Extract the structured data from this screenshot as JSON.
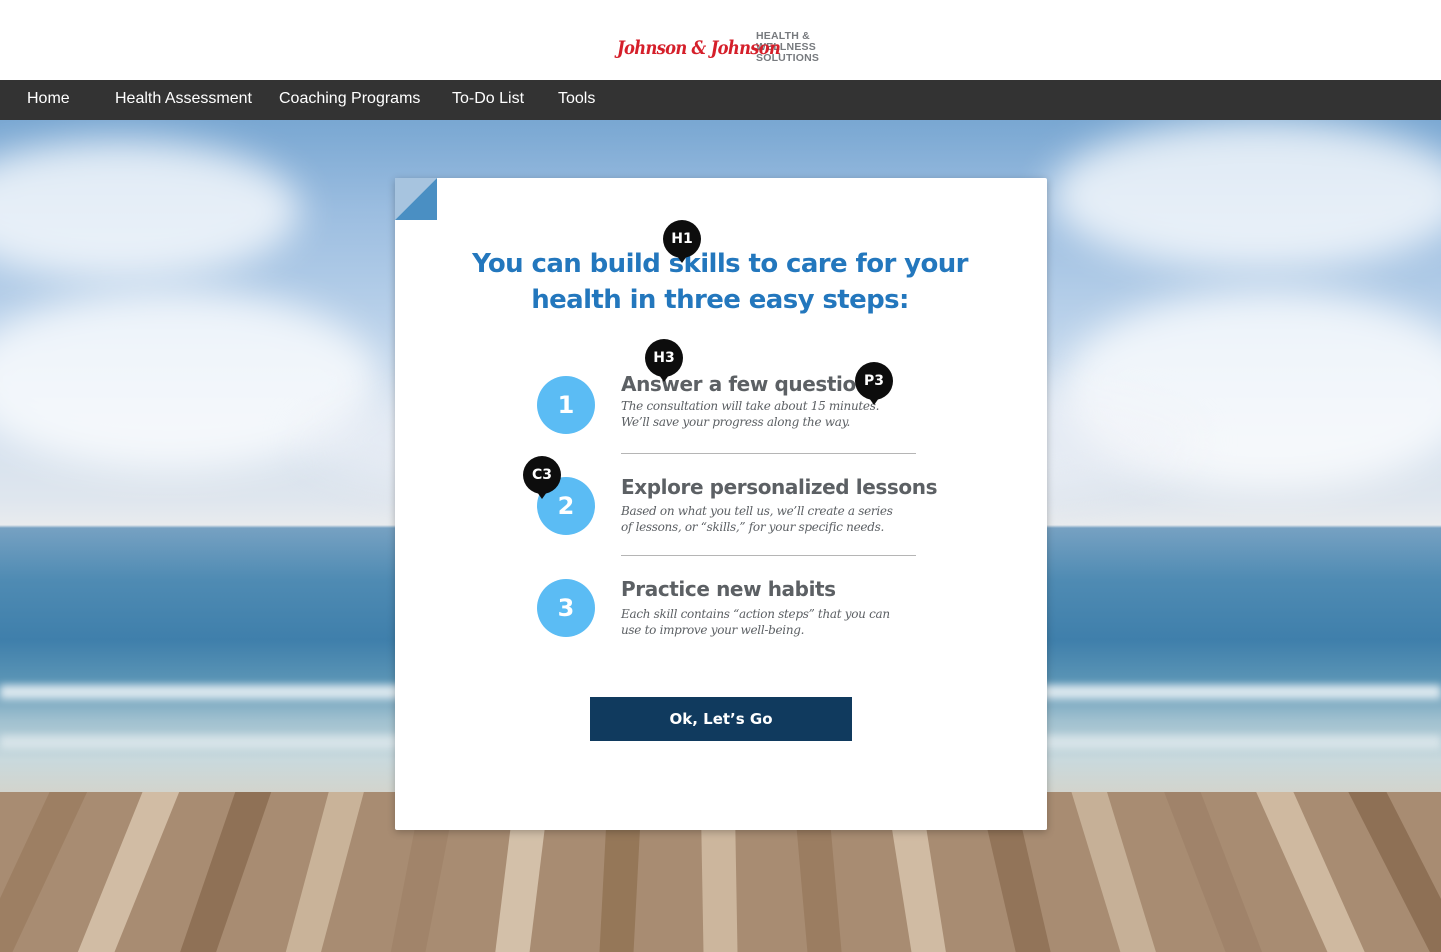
{
  "header": {
    "logo_script": "Johnson & Johnson",
    "logo_lines": [
      "HEALTH &",
      "WELLNESS",
      "SOLUTIONS"
    ],
    "logo_color": "#d51f2a"
  },
  "nav": {
    "items": [
      {
        "label": "Home"
      },
      {
        "label": "Health Assessment"
      },
      {
        "label": "Coaching Programs"
      },
      {
        "label": "To-Do List"
      },
      {
        "label": "Tools"
      }
    ],
    "background": "#333333"
  },
  "card": {
    "title": "You can build skills to care for your health in three easy steps:",
    "steps": [
      {
        "number": "1",
        "title": "Answer a few questions",
        "description": "The consultation will take about 15 minutes.  We’ll save your progress along the way."
      },
      {
        "number": "2",
        "title": "Explore personalized lessons",
        "description": "Based on what you tell us, we’ll create a series of lessons, or “skills,” for your specific needs."
      },
      {
        "number": "3",
        "title": "Practice new habits",
        "description": "Each skill contains “action steps” that you can use to improve your well-being."
      }
    ],
    "cta_label": "Ok, Let’s Go",
    "accent_color": "#2377bd",
    "circle_color": "#5bbcf4",
    "button_color": "#103a5e"
  },
  "markers": [
    "H1",
    "H3",
    "P3",
    "C3"
  ]
}
